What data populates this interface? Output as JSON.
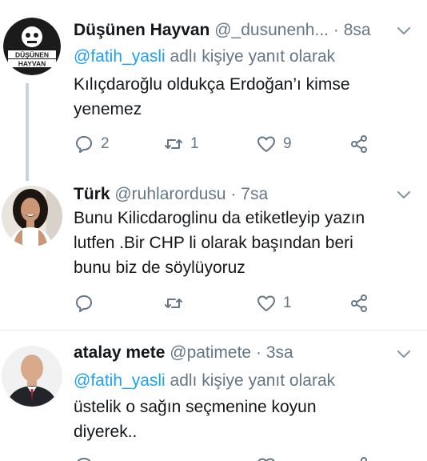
{
  "tweets": [
    {
      "name": "Düşünen Hayvan",
      "handle": "@_dusunenh...",
      "separator": "·",
      "time": "8sa",
      "reply_prefix": "",
      "reply_mention": "@fatih_yasli",
      "reply_suffix": " adlı kişiye yanıt olarak",
      "text_lines": [
        "Kılıçdaroğlu oldukça Erdoğan’ı kimse",
        "yenemez"
      ],
      "replies": "2",
      "retweets": "1",
      "likes": "9",
      "avatar_text": [
        "DÜŞÜNEN",
        "HAYVAN"
      ]
    },
    {
      "name": "Türk",
      "handle": "@ruhlarordusu",
      "separator": "·",
      "time": "7sa",
      "text_lines": [
        "Bunu Kilicdaroglinu da etiketleyip yazın",
        "lutfen .Bir CHP li olarak başından beri",
        "bunu biz de söylüyoruz"
      ],
      "replies": "",
      "retweets": "",
      "likes": "1"
    },
    {
      "name": "atalay mete",
      "handle": "@patimete",
      "separator": "·",
      "time": "3sa",
      "reply_mention": "@fatih_yasli",
      "reply_suffix": " adlı kişiye yanıt olarak",
      "text_lines": [
        "üstelik o sağın seçmenine koyun",
        "diyerek.."
      ]
    }
  ],
  "colors": {
    "accent": "#1da1f2",
    "muted": "#657786",
    "text": "#14171a",
    "divider": "#e1e8ed"
  }
}
